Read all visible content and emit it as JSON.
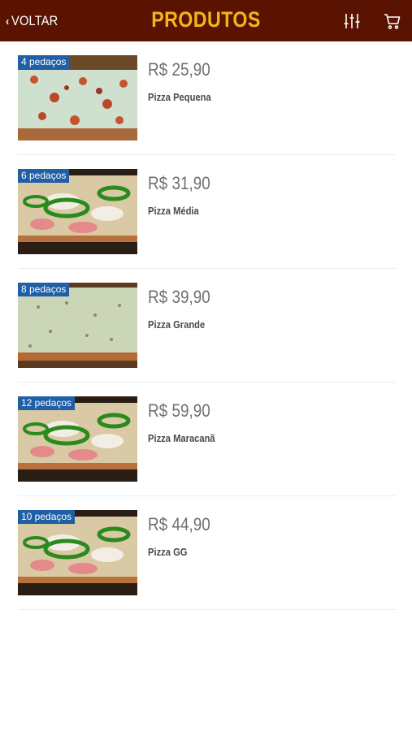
{
  "header": {
    "back_label": "VOLTAR",
    "title": "PRODUTOS",
    "filter_icon": "sliders-icon",
    "cart_icon": "cart-icon"
  },
  "colors": {
    "header_bg": "#5a1300",
    "title": "#f3b51a",
    "badge_bg": "#1f5fa6"
  },
  "products": [
    {
      "badge": "4 pedaços",
      "price": "R$ 25,90",
      "name": "Pizza Pequena",
      "image": "cheese-pizza"
    },
    {
      "badge": "6 pedaços",
      "price": "R$ 31,90",
      "name": "Pizza Média",
      "image": "pepper-pizza"
    },
    {
      "badge": "8 pedaços",
      "price": "R$ 39,90",
      "name": "Pizza Grande",
      "image": "white-pizza"
    },
    {
      "badge": "12 pedaços",
      "price": "R$ 59,90",
      "name": "Pizza Maracanã",
      "image": "pepper-pizza"
    },
    {
      "badge": "10 pedaços",
      "price": "R$ 44,90",
      "name": "Pizza GG",
      "image": "pepper-pizza"
    }
  ]
}
